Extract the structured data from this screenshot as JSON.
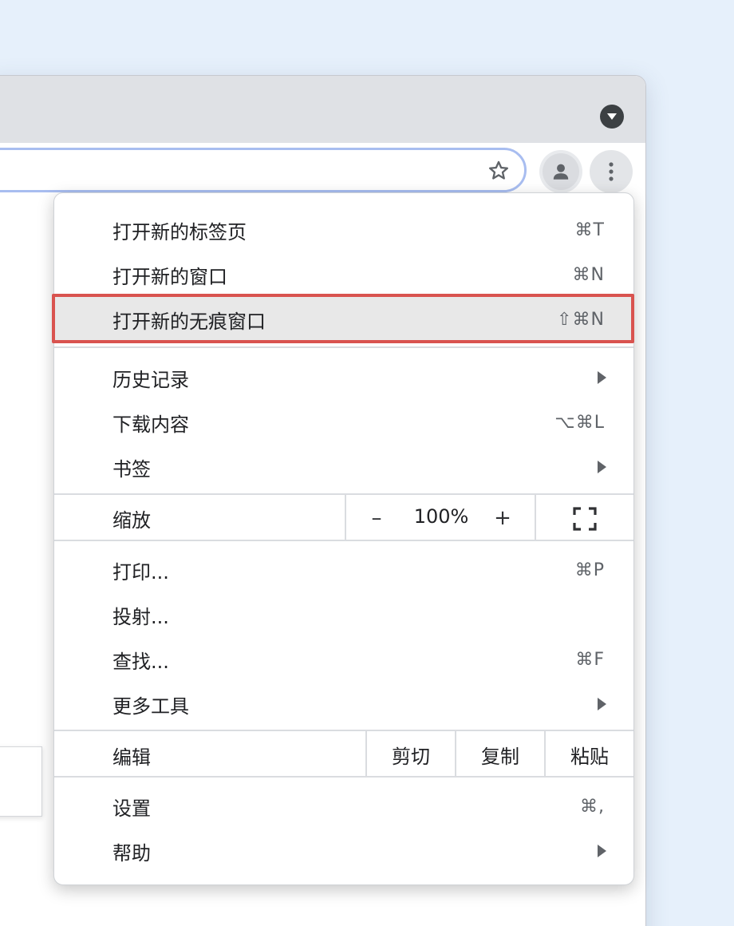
{
  "menu": {
    "group1": [
      {
        "label": "打开新的标签页",
        "shortcut": "⌘T"
      },
      {
        "label": "打开新的窗口",
        "shortcut": "⌘N"
      },
      {
        "label": "打开新的无痕窗口",
        "shortcut": "⇧⌘N"
      }
    ],
    "group2": [
      {
        "label": "历史记录"
      },
      {
        "label": "下载内容",
        "shortcut": "⌥⌘L"
      },
      {
        "label": "书签"
      }
    ],
    "zoom": {
      "label": "缩放",
      "minus": "–",
      "value": "100%",
      "plus": "+"
    },
    "group3": [
      {
        "label": "打印...",
        "shortcut": "⌘P"
      },
      {
        "label": "投射..."
      },
      {
        "label": "查找...",
        "shortcut": "⌘F"
      },
      {
        "label": "更多工具"
      }
    ],
    "edit": {
      "label": "编辑",
      "cut": "剪切",
      "copy": "复制",
      "paste": "粘贴"
    },
    "group4": [
      {
        "label": "设置",
        "shortcut": "⌘,"
      },
      {
        "label": "帮助"
      }
    ]
  },
  "colors": {
    "highlight_border": "#d9534f",
    "highlight_bg": "#e8e8e8",
    "omnibox_focus": "#a8bdf0"
  },
  "icons": [
    "tab-search-icon",
    "star-icon",
    "profile-icon",
    "kebab-menu-icon",
    "submenu-arrow-icon",
    "fullscreen-icon"
  ]
}
